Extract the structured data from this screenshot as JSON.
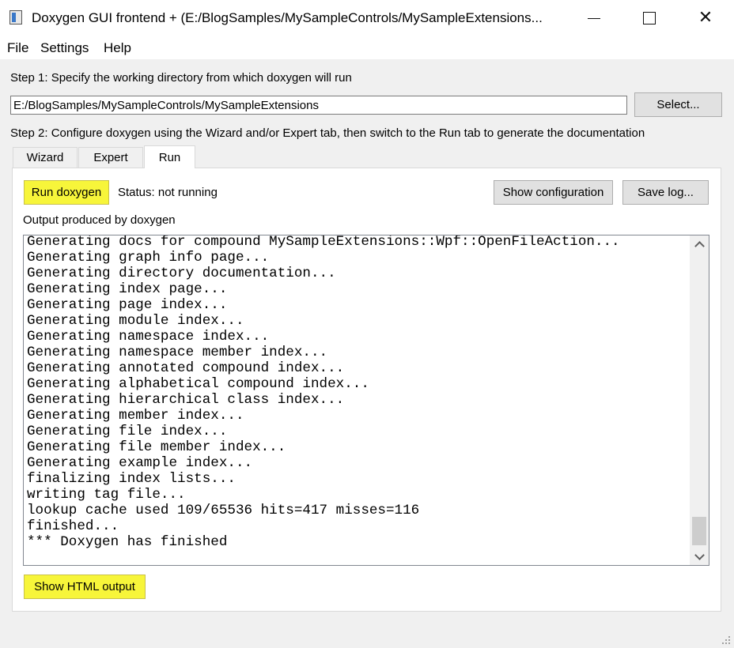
{
  "window": {
    "title": "Doxygen GUI frontend + (E:/BlogSamples/MySampleControls/MySampleExtensions...",
    "minimize_icon": "minimize-icon",
    "maximize_icon": "maximize-icon",
    "close_icon": "close-icon"
  },
  "menu": {
    "items": [
      {
        "label": "File"
      },
      {
        "label": "Settings"
      },
      {
        "label": "Help"
      }
    ]
  },
  "step1": {
    "label": "Step 1: Specify the working directory from which doxygen will run",
    "directory_value": "E:/BlogSamples/MySampleControls/MySampleExtensions",
    "select_button": "Select..."
  },
  "step2": {
    "label": "Step 2: Configure doxygen using the Wizard and/or Expert tab, then switch to the Run tab to generate the documentation"
  },
  "tabs": [
    {
      "label": "Wizard",
      "active": false
    },
    {
      "label": "Expert",
      "active": false
    },
    {
      "label": "Run",
      "active": true
    }
  ],
  "run_panel": {
    "run_button": "Run doxygen",
    "status": "Status: not running",
    "show_configuration_button": "Show configuration",
    "save_log_button": "Save log...",
    "output_label": "Output produced by doxygen",
    "output_lines": [
      "Generating docs for compound MySampleExtensions::Wpf::OpenFileAction...",
      "Generating graph info page...",
      "Generating directory documentation...",
      "Generating index page...",
      "Generating page index...",
      "Generating module index...",
      "Generating namespace index...",
      "Generating namespace member index...",
      "Generating annotated compound index...",
      "Generating alphabetical compound index...",
      "Generating hierarchical class index...",
      "Generating member index...",
      "Generating file index...",
      "Generating file member index...",
      "Generating example index...",
      "finalizing index lists...",
      "writing tag file...",
      "lookup cache used 109/65536 hits=417 misses=116",
      "finished...",
      "*** Doxygen has finished"
    ],
    "show_html_button": "Show HTML output"
  },
  "colors": {
    "highlight": "#fbf53a",
    "window_bg": "#f0f0f0",
    "panel_bg": "#ffffff"
  }
}
